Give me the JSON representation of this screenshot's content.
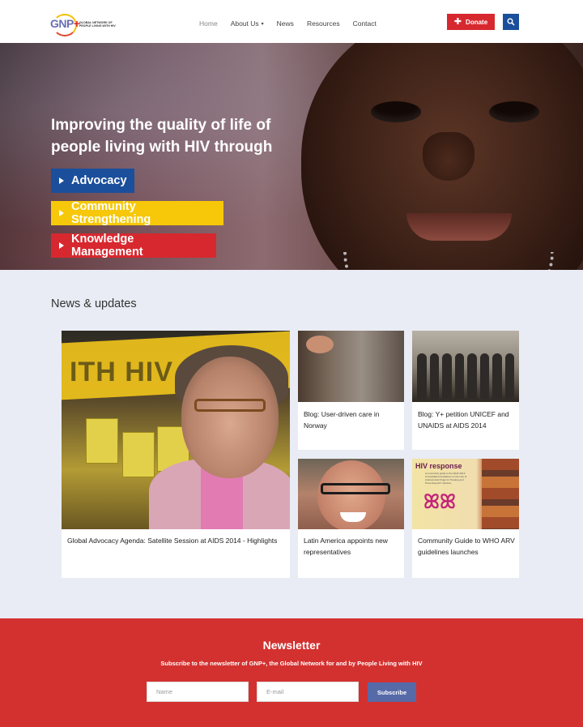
{
  "header": {
    "logo": {
      "mark": "GNP",
      "plus": "+",
      "tagline": "GLOBAL NETWORK OF PEOPLE LIVING WITH HIV"
    },
    "nav": [
      {
        "label": "Home",
        "active": true
      },
      {
        "label": "About Us",
        "has_dropdown": true
      },
      {
        "label": "News"
      },
      {
        "label": "Resources"
      },
      {
        "label": "Contact"
      }
    ],
    "donate_label": "Donate",
    "icons": {
      "donate": "plus-icon",
      "search": "search-icon"
    },
    "colors": {
      "red": "#d7282f",
      "blue": "#1b4f9c",
      "yellow": "#f6c809"
    }
  },
  "hero": {
    "title": "Improving the quality of life of people living with HIV through",
    "pills": [
      {
        "label": "Advocacy",
        "color": "#1b4f9c"
      },
      {
        "label": "Community Strengthening",
        "color": "#f6c809"
      },
      {
        "label": "Knowledge Management",
        "color": "#d7282f"
      }
    ]
  },
  "news": {
    "heading": "News & updates",
    "cards": [
      {
        "caption": "Global Advocacy Agenda: Satellite Session at AIDS 2014 - Highlights"
      },
      {
        "caption": "Blog: User-driven care in Norway"
      },
      {
        "caption": "Blog: Y+ petition UNICEF and UNAIDS at AIDS 2014"
      },
      {
        "caption": "Latin America appoints new representatives"
      },
      {
        "caption": "Community Guide to WHO ARV guidelines launches"
      }
    ],
    "image_text": {
      "banner": "ITH HIV",
      "placard": "PEOPLE LIVING WITH HIV ARE",
      "guide_title": "HIV response",
      "guide_sub": "A community guide to the WHO 2013 Consolidated Guidelines on the Use of Antiretroviral Drugs for Treating and Preventing HIV Infection"
    }
  },
  "newsletter": {
    "title": "Newsletter",
    "subtitle": "Subscribe to the newsletter of GNP+, the Global Network for and by People Living with HIV",
    "name_placeholder": "Name",
    "email_placeholder": "E-mail",
    "subscribe_label": "Subscribe"
  }
}
